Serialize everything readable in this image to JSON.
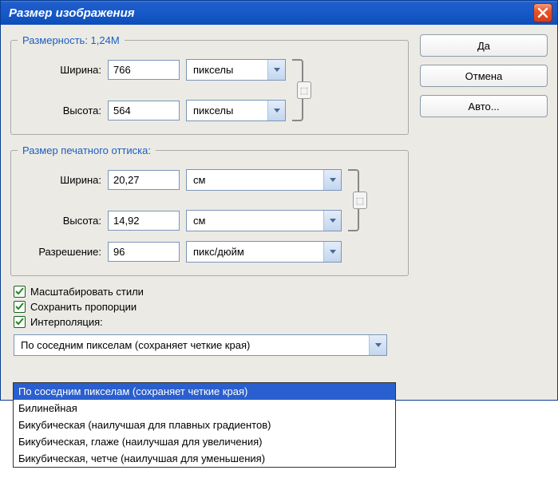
{
  "title": "Размер изображения",
  "buttons": {
    "ok": "Да",
    "cancel": "Отмена",
    "auto": "Авто..."
  },
  "dimensions": {
    "legend": "Размерность:  1,24M",
    "widthLabel": "Ширина:",
    "widthValue": "766",
    "widthUnit": "пикселы",
    "heightLabel": "Высота:",
    "heightValue": "564",
    "heightUnit": "пикселы"
  },
  "print": {
    "legend": "Размер печатного оттиска:",
    "widthLabel": "Ширина:",
    "widthValue": "20,27",
    "widthUnit": "см",
    "heightLabel": "Высота:",
    "heightValue": "14,92",
    "heightUnit": "см",
    "resLabel": "Разрешение:",
    "resValue": "96",
    "resUnit": "пикс/дюйм"
  },
  "checkboxes": {
    "scaleStyles": "Масштабировать стили",
    "constrain": "Сохранить пропорции",
    "resample": "Интерполяция:"
  },
  "interpolation": {
    "selected": "По соседним пикселам (сохраняет четкие края)",
    "options": [
      "По соседним пикселам (сохраняет четкие края)",
      "Билинейная",
      "Бикубическая (наилучшая для плавных градиентов)",
      "Бикубическая, глаже (наилучшая для увеличения)",
      "Бикубическая, четче (наилучшая для уменьшения)"
    ]
  }
}
